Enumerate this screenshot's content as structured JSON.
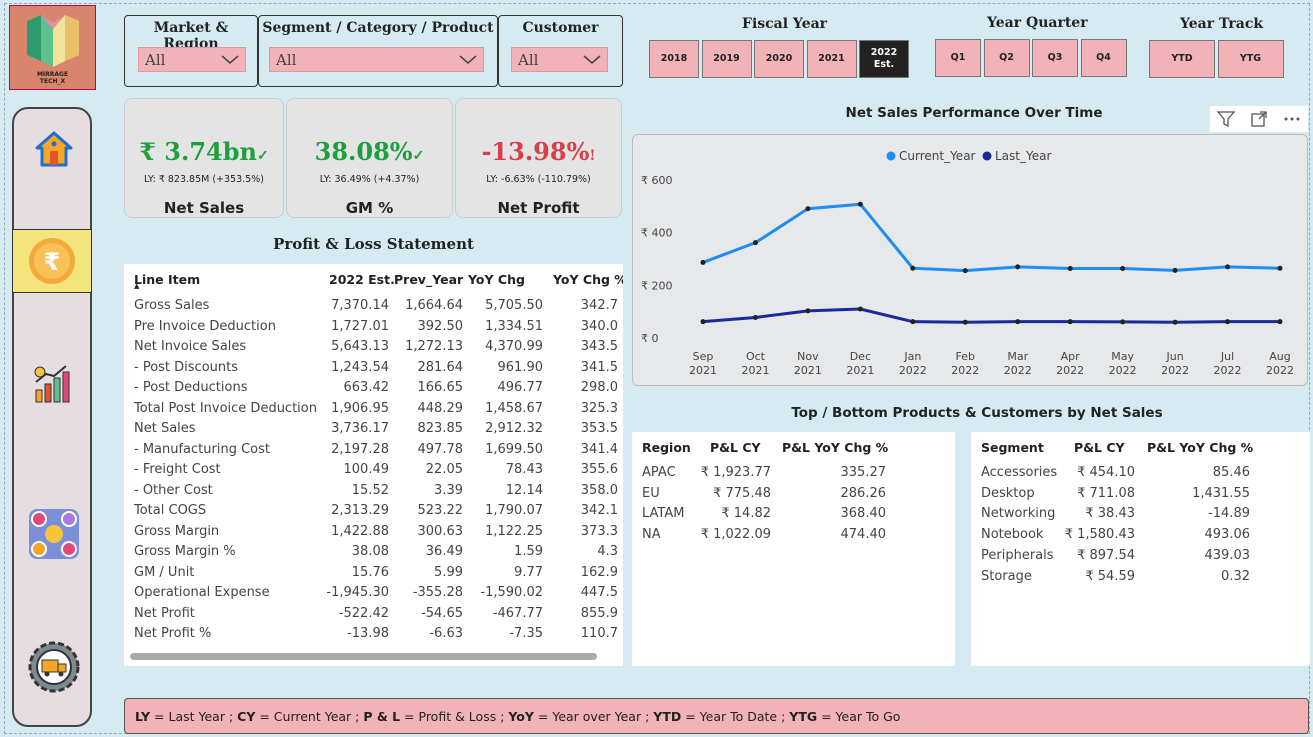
{
  "logo": {
    "text": "MIRRAGE TECH_X"
  },
  "filters": {
    "market": {
      "title": "Market & Region",
      "value": "All"
    },
    "segment": {
      "title": "Segment / Category / Product",
      "value": "All"
    },
    "customer": {
      "title": "Customer",
      "value": "All"
    }
  },
  "kpis": [
    {
      "value": "₹ 3.74bn",
      "mark": "✓",
      "ly": "LY: ₹ 823.85M (+353.5%)",
      "name": "Net Sales",
      "color": "#1f9e3e"
    },
    {
      "value": "38.08%",
      "mark": "✓",
      "ly": "LY: 36.49% (+4.37%)",
      "name": "GM %",
      "color": "#1f9e3e"
    },
    {
      "value": "-13.98%",
      "mark": "!",
      "ly": "LY: -6.63% (-110.79%)",
      "name": "Net Profit",
      "color": "#d6404a"
    }
  ],
  "fiscal_year": {
    "title": "Fiscal Year",
    "options": [
      "2018",
      "2019",
      "2020",
      "2021",
      "2022 Est."
    ],
    "selected": "2022 Est."
  },
  "year_quarter": {
    "title": "Year Quarter",
    "options": [
      "Q1",
      "Q2",
      "Q3",
      "Q4"
    ]
  },
  "year_track": {
    "title": "Year Track",
    "options": [
      "YTD",
      "YTG"
    ]
  },
  "pl": {
    "title": "Profit & Loss Statement",
    "columns": [
      "Line Item",
      "2022 Est.",
      "Prev_Year",
      "YoY Chg",
      "YoY Chg %"
    ],
    "rows": [
      [
        "Gross Sales",
        "7,370.14",
        "1,664.64",
        "5,705.50",
        "342.7"
      ],
      [
        "Pre Invoice Deduction",
        "1,727.01",
        "392.50",
        "1,334.51",
        "340.0"
      ],
      [
        "Net Invoice Sales",
        "5,643.13",
        "1,272.13",
        "4,370.99",
        "343.5"
      ],
      [
        "- Post Discounts",
        "1,243.54",
        "281.64",
        "961.90",
        "341.5"
      ],
      [
        "- Post Deductions",
        "663.42",
        "166.65",
        "496.77",
        "298.0"
      ],
      [
        "Total Post Invoice Deduction",
        "1,906.95",
        "448.29",
        "1,458.67",
        "325.3"
      ],
      [
        "Net Sales",
        "3,736.17",
        "823.85",
        "2,912.32",
        "353.5"
      ],
      [
        "- Manufacturing Cost",
        "2,197.28",
        "497.78",
        "1,699.50",
        "341.4"
      ],
      [
        "- Freight Cost",
        "100.49",
        "22.05",
        "78.43",
        "355.6"
      ],
      [
        "- Other Cost",
        "15.52",
        "3.39",
        "12.14",
        "358.0"
      ],
      [
        "Total COGS",
        "2,313.29",
        "523.22",
        "1,790.07",
        "342.1"
      ],
      [
        "Gross Margin",
        "1,422.88",
        "300.63",
        "1,122.25",
        "373.3"
      ],
      [
        "Gross Margin %",
        "38.08",
        "36.49",
        "1.59",
        "4.3"
      ],
      [
        "GM / Unit",
        "15.76",
        "5.99",
        "9.77",
        "162.9"
      ],
      [
        "Operational Expense",
        "-1,945.30",
        "-355.28",
        "-1,590.02",
        "447.5"
      ],
      [
        "Net Profit",
        "-522.42",
        "-54.65",
        "-467.77",
        "855.9"
      ],
      [
        "Net Profit %",
        "-13.98",
        "-6.63",
        "-7.35",
        "110.7"
      ]
    ]
  },
  "chart_data": {
    "type": "line",
    "title": "Net Sales Performance Over Time",
    "categories": [
      "Sep 2021",
      "Oct 2021",
      "Nov 2021",
      "Dec 2021",
      "Jan 2022",
      "Feb 2022",
      "Mar 2022",
      "Apr 2022",
      "May 2022",
      "Jun 2022",
      "Jul 2022",
      "Aug 2022"
    ],
    "series": [
      {
        "name": "Current_Year",
        "color": "#1e8ef0",
        "values": [
          287,
          362,
          491,
          508,
          265,
          256,
          270,
          264,
          264,
          257,
          270,
          265
        ]
      },
      {
        "name": "Last_Year",
        "color": "#1a2a9a",
        "values": [
          62,
          78,
          103,
          110,
          62,
          60,
          62,
          62,
          61,
          60,
          62,
          62
        ]
      }
    ],
    "yticks": [
      "₹ 0",
      "₹ 200",
      "₹ 400",
      "₹ 600"
    ],
    "ylim": [
      0,
      600
    ],
    "legend": "top-center"
  },
  "topbottom": {
    "title": "Top / Bottom Products & Customers by Net Sales",
    "region": {
      "columns": [
        "Region",
        "P&L CY",
        "P&L YoY Chg %"
      ],
      "rows": [
        [
          "APAC",
          "₹ 1,923.77",
          "335.27"
        ],
        [
          "EU",
          "₹ 775.48",
          "286.26"
        ],
        [
          "LATAM",
          "₹ 14.82",
          "368.40"
        ],
        [
          "NA",
          "₹ 1,022.09",
          "474.40"
        ]
      ]
    },
    "segment": {
      "columns": [
        "Segment",
        "P&L CY",
        "P&L YoY Chg %"
      ],
      "rows": [
        [
          "Accessories",
          "₹ 454.10",
          "85.46"
        ],
        [
          "Desktop",
          "₹ 711.08",
          "1,431.55"
        ],
        [
          "Networking",
          "₹ 38.43",
          "-14.89"
        ],
        [
          "Notebook",
          "₹ 1,580.43",
          "493.06"
        ],
        [
          "Peripherals",
          "₹ 897.54",
          "439.03"
        ],
        [
          "Storage",
          "₹ 54.59",
          "0.32"
        ]
      ]
    }
  },
  "footer": [
    {
      "abbr": "LY",
      "desc": " = Last Year ; "
    },
    {
      "abbr": "CY",
      "desc": " = Current Year ; "
    },
    {
      "abbr": "P & L",
      "desc": " = Profit & Loss ; "
    },
    {
      "abbr": "YoY",
      "desc": " = Year over Year ; "
    },
    {
      "abbr": "YTD",
      "desc": " = Year To Date ; "
    },
    {
      "abbr": "YTG",
      "desc": " = Year To Go"
    }
  ]
}
